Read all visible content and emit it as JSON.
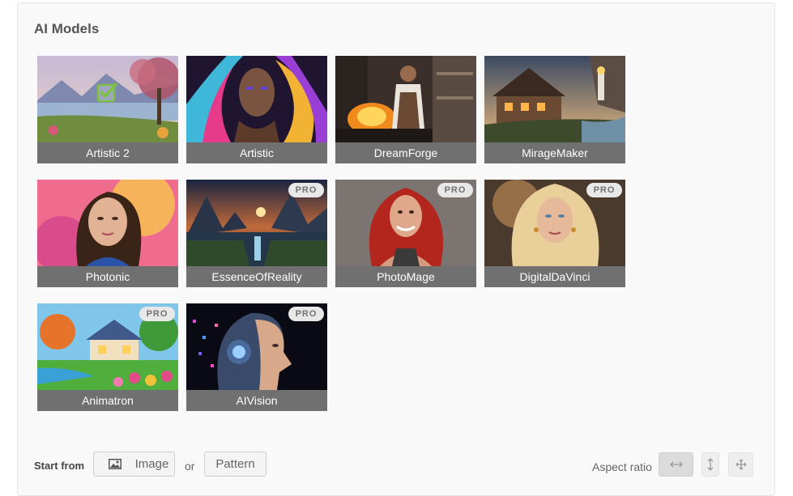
{
  "section_title": "AI Models",
  "models": [
    {
      "name": "Artistic 2",
      "pro": false,
      "selected": true,
      "icon": "landscape-painting"
    },
    {
      "name": "Artistic",
      "pro": false,
      "selected": false,
      "icon": "colorful-portrait"
    },
    {
      "name": "DreamForge",
      "pro": false,
      "selected": false,
      "icon": "blacksmith"
    },
    {
      "name": "MirageMaker",
      "pro": false,
      "selected": false,
      "icon": "cottage-lighthouse"
    },
    {
      "name": "Photonic",
      "pro": false,
      "selected": false,
      "icon": "woman-portrait"
    },
    {
      "name": "EssenceOfReality",
      "pro": true,
      "selected": false,
      "icon": "mountain-sunset"
    },
    {
      "name": "PhotoMage",
      "pro": true,
      "selected": false,
      "icon": "red-hair-portrait"
    },
    {
      "name": "DigitalDaVinci",
      "pro": true,
      "selected": false,
      "icon": "blonde-portrait"
    },
    {
      "name": "Animatron",
      "pro": true,
      "selected": false,
      "icon": "cartoon-cottage"
    },
    {
      "name": "AIVision",
      "pro": true,
      "selected": false,
      "icon": "cyborg-head"
    }
  ],
  "pro_label": "PRO",
  "start_from": {
    "label": "Start from",
    "image_button": "Image",
    "or_label": "or",
    "pattern_button": "Pattern"
  },
  "aspect_ratio": {
    "label": "Aspect ratio",
    "options": [
      "wide",
      "tall",
      "free"
    ],
    "selected": "wide"
  },
  "colors": {
    "caption_bg": "#707070",
    "check_green": "#7dc142",
    "badge_bg": "#e8e8e8"
  }
}
